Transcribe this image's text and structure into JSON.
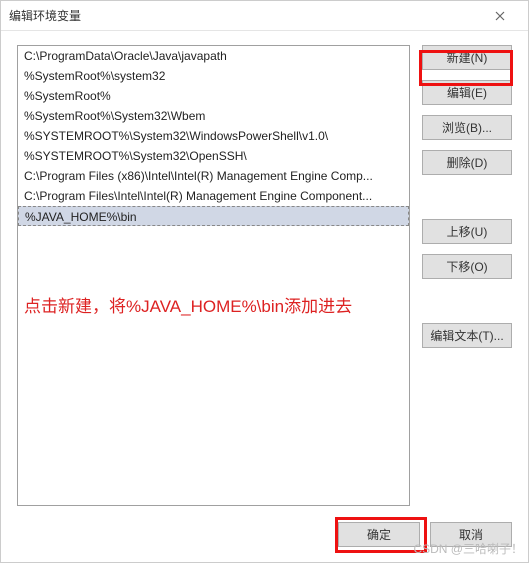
{
  "dialog": {
    "title": "编辑环境变量"
  },
  "list": {
    "items": [
      "C:\\ProgramData\\Oracle\\Java\\javapath",
      "%SystemRoot%\\system32",
      "%SystemRoot%",
      "%SystemRoot%\\System32\\Wbem",
      "%SYSTEMROOT%\\System32\\WindowsPowerShell\\v1.0\\",
      "%SYSTEMROOT%\\System32\\OpenSSH\\",
      "C:\\Program Files (x86)\\Intel\\Intel(R) Management Engine Comp...",
      "C:\\Program Files\\Intel\\Intel(R) Management Engine Component...",
      "%JAVA_HOME%\\bin"
    ],
    "selected_index": 8
  },
  "buttons": {
    "new": "新建(N)",
    "edit": "编辑(E)",
    "browse": "浏览(B)...",
    "delete": "删除(D)",
    "moveup": "上移(U)",
    "movedown": "下移(O)",
    "edittext": "编辑文本(T)...",
    "ok": "确定",
    "cancel": "取消"
  },
  "annotation": "点击新建，将%JAVA_HOME%\\bin添加进去",
  "watermark": "CSDN @三哈喇子！"
}
